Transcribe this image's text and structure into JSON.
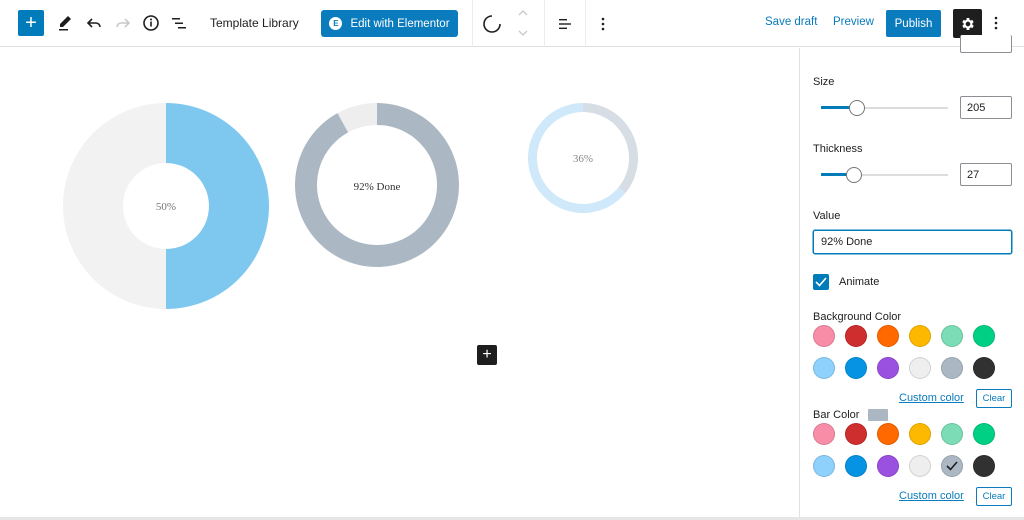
{
  "toolbar": {
    "add_icon": "plus-icon",
    "tools_icon": "pencil-icon",
    "undo_icon": "undo-icon",
    "redo_icon": "redo-icon",
    "info_icon": "info-icon",
    "outline_icon": "list-view-icon",
    "template_title": "Template Library",
    "elementor_label": "Edit with Elementor",
    "elementor_logo": "E",
    "save_draft": "Save draft",
    "preview": "Preview",
    "publish": "Publish"
  },
  "canvas": {
    "charts": [
      {
        "label": "50%",
        "value_percent": 50,
        "bar_color": "#7ec8f0",
        "background_color": "#f2f2f2",
        "thickness": "thick"
      },
      {
        "label": "92% Done",
        "value_percent": 92,
        "bar_color": "#abb8c3",
        "background_color": "#eeeeee",
        "thickness": "medium"
      },
      {
        "label": "36%",
        "value_percent": 36,
        "bar_color": "#d6dde4",
        "background_color": "#cfe9fa",
        "thickness": "thin"
      }
    ],
    "add_block_icon": "plus-icon"
  },
  "sidebar": {
    "size": {
      "label": "Size",
      "value": "205",
      "slider_fraction": 0.28
    },
    "thickness": {
      "label": "Thickness",
      "value": "27",
      "slider_fraction": 0.26
    },
    "value": {
      "label": "Value",
      "input": "92% Done"
    },
    "animate": {
      "label": "Animate",
      "checked": true
    },
    "background_color": {
      "label": "Background Color",
      "swatches": [
        "#f78da7",
        "#cf2e2e",
        "#ff6900",
        "#fcb900",
        "#7bdcb5",
        "#00d084",
        "#8ed1fc",
        "#0693e3",
        "#9b51e0",
        "#eeeeee",
        "#abb8c3",
        "#313131"
      ],
      "custom_link": "Custom color",
      "clear": "Clear"
    },
    "bar_color": {
      "label": "Bar Color",
      "current": "#abb8c3",
      "selected_index": 10,
      "swatches": [
        "#f78da7",
        "#cf2e2e",
        "#ff6900",
        "#fcb900",
        "#7bdcb5",
        "#00d084",
        "#8ed1fc",
        "#0693e3",
        "#9b51e0",
        "#eeeeee",
        "#abb8c3",
        "#313131"
      ],
      "custom_link": "Custom color",
      "clear": "Clear"
    }
  }
}
